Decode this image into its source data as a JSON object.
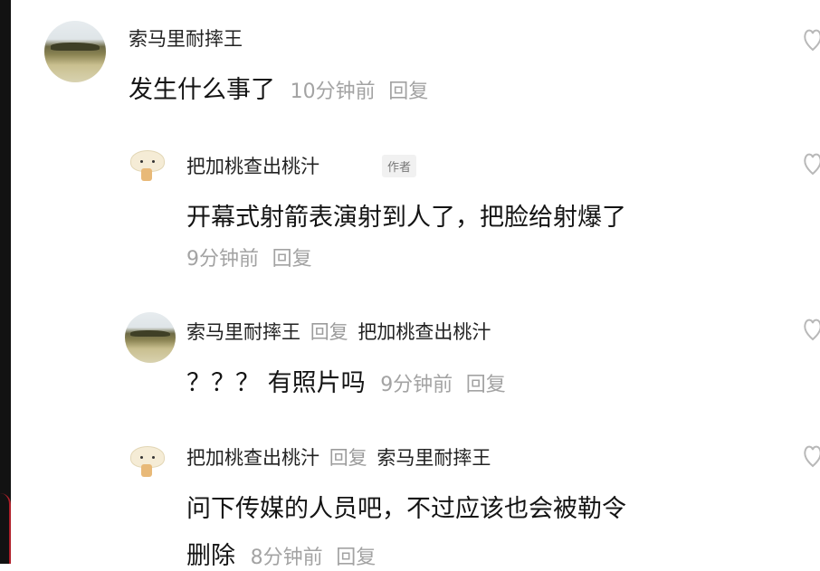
{
  "comments": [
    {
      "user": "索马里耐摔王",
      "text": "发生什么事了",
      "time": "10分钟前",
      "reply_label": "回复",
      "avatar": "field-landscape-avatar"
    },
    {
      "user": "把加桃查出桃汁",
      "badge": "作者",
      "text": "开幕式射箭表演射到人了，把脸给射爆了",
      "time": "9分钟前",
      "reply_label": "回复",
      "avatar": "cat-dumpling-avatar"
    },
    {
      "user": "索马里耐摔王",
      "reply_to_word": "回复",
      "reply_to": "把加桃查出桃汁",
      "text": "？？？ 有照片吗",
      "time": "9分钟前",
      "reply_label": "回复",
      "avatar": "field-landscape-avatar"
    },
    {
      "user": "把加桃查出桃汁",
      "reply_to_word": "回复",
      "reply_to": "索马里耐摔王",
      "text_line1": "问下传媒的人员吧，不过应该也会被勒令",
      "text_line2": "删除",
      "time": "8分钟前",
      "reply_label": "回复",
      "avatar": "cat-dumpling-avatar"
    }
  ],
  "icons": {
    "like": "heart-outline-icon"
  },
  "colors": {
    "text": "#141414",
    "meta": "#a3a3a3",
    "badge_bg": "#f1f1f1"
  }
}
